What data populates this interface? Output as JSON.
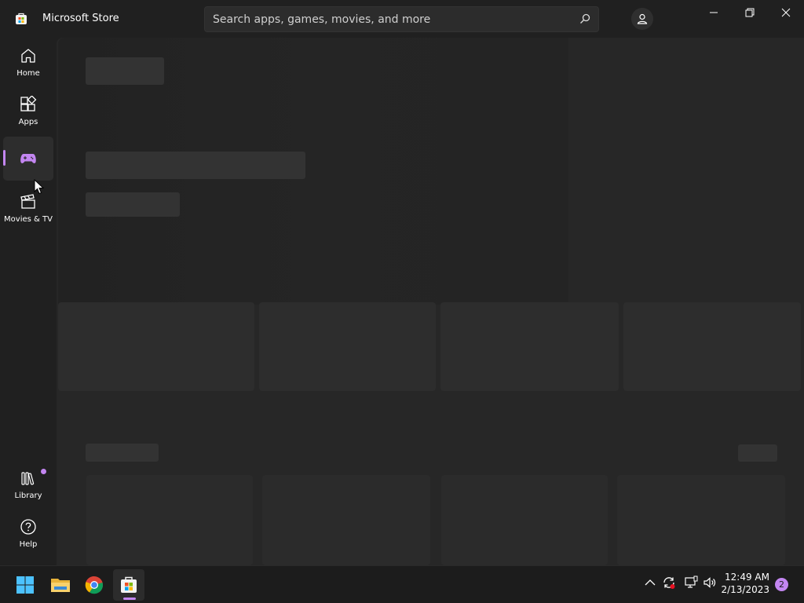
{
  "app": {
    "title": "Microsoft Store"
  },
  "search": {
    "placeholder": "Search apps, games, movies, and more"
  },
  "nav": {
    "items": [
      {
        "label": "Home",
        "icon": "home-icon"
      },
      {
        "label": "Apps",
        "icon": "apps-icon"
      },
      {
        "label": "",
        "icon": "gamepad-icon",
        "active": true
      },
      {
        "label": "Movies & TV",
        "icon": "clapperboard-icon"
      }
    ],
    "bottom": [
      {
        "label": "Library",
        "icon": "library-icon",
        "has_badge": true
      },
      {
        "label": "Help",
        "icon": "help-icon"
      }
    ]
  },
  "taskbar": {
    "apps": [
      "start-icon",
      "file-explorer-icon",
      "chrome-icon",
      "microsoft-store-icon"
    ],
    "clock": {
      "time": "12:49 AM",
      "date": "2/13/2023"
    },
    "notifications": "2"
  },
  "colors": {
    "accent": "#c386f1",
    "background": "#202020",
    "skeleton": "#333333"
  }
}
